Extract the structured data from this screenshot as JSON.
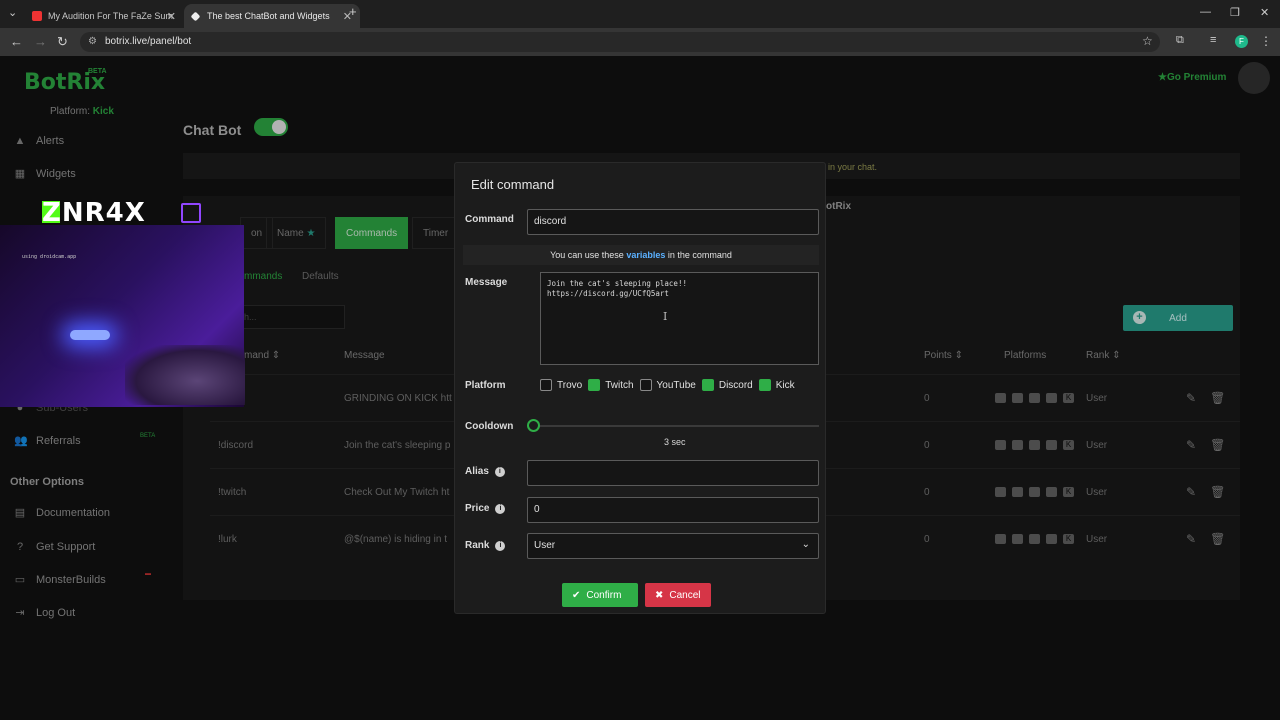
{
  "browser": {
    "tabs": [
      {
        "title": "My Audition For The FaZe Sum"
      },
      {
        "title": "The best ChatBot and Widgets"
      }
    ],
    "url": "botrix.live/panel/bot",
    "profile_initial": "F"
  },
  "app": {
    "logo": "BotRix",
    "logo_badge": "BETA",
    "platform_label": "Platform:",
    "platform_value": "Kick",
    "go_premium": "Go Premium"
  },
  "sidebar": {
    "items": [
      {
        "label": "Alerts"
      },
      {
        "label": "Widgets"
      },
      {
        "label": "Sub-Users"
      },
      {
        "label": "Referrals"
      }
    ],
    "referrals_badge": "BETA",
    "other_heading": "Other Options",
    "other_items": [
      {
        "label": "Documentation"
      },
      {
        "label": "Get Support"
      },
      {
        "label": "MonsterBuilds"
      },
      {
        "label": "Log Out"
      }
    ]
  },
  "main": {
    "title": "Chat Bot",
    "notice_text": "in your chat.",
    "card_title": "otRix",
    "tabs": [
      {
        "label": "on"
      },
      {
        "label": "Name"
      },
      {
        "label": "Commands"
      },
      {
        "label": "Timer"
      }
    ],
    "subtabs": [
      {
        "label": "mmands"
      },
      {
        "label": "Defaults"
      }
    ],
    "search_placeholder": "h...",
    "add_label": "Add",
    "columns": {
      "command": "mand",
      "message": "Message",
      "points": "Points",
      "platforms": "Platforms",
      "rank": "Rank"
    },
    "rows": [
      {
        "command": "",
        "message": "GRINDING ON KICK htt",
        "points": "0",
        "rank": "User"
      },
      {
        "command": "!discord",
        "message": "Join the cat's sleeping p",
        "points": "0",
        "rank": "User"
      },
      {
        "command": "!twitch",
        "message": "Check Out My Twitch ht",
        "points": "0",
        "rank": "User"
      },
      {
        "command": "!lurk",
        "message": "@$(name) is hiding in t",
        "points": "0",
        "rank": "User"
      }
    ]
  },
  "stream_overlay": {
    "name": "ZNR4X",
    "hint": "using droidcam.app"
  },
  "modal": {
    "title": "Edit command",
    "command_label": "Command",
    "command_value": "discord",
    "variables_prefix": "You can use these",
    "variables_link": "variables",
    "variables_suffix": "in the command",
    "message_label": "Message",
    "message_value": "Join the cat's sleeping place!!\nhttps://discord.gg/UCfQ5art",
    "platform_label": "Platform",
    "platforms": [
      {
        "name": "Trovo",
        "checked": false
      },
      {
        "name": "Twitch",
        "checked": true
      },
      {
        "name": "YouTube",
        "checked": false
      },
      {
        "name": "Discord",
        "checked": true
      },
      {
        "name": "Kick",
        "checked": true
      }
    ],
    "cooldown_label": "Cooldown",
    "cooldown_value": "3 sec",
    "alias_label": "Alias",
    "alias_value": "",
    "price_label": "Price",
    "price_value": "0",
    "rank_label": "Rank",
    "rank_value": "User",
    "confirm_label": "Confirm",
    "cancel_label": "Cancel"
  },
  "colors": {
    "accent": "#2fae47",
    "teal": "#2aa391",
    "danger": "#d63547",
    "link": "#5ab0ff"
  }
}
